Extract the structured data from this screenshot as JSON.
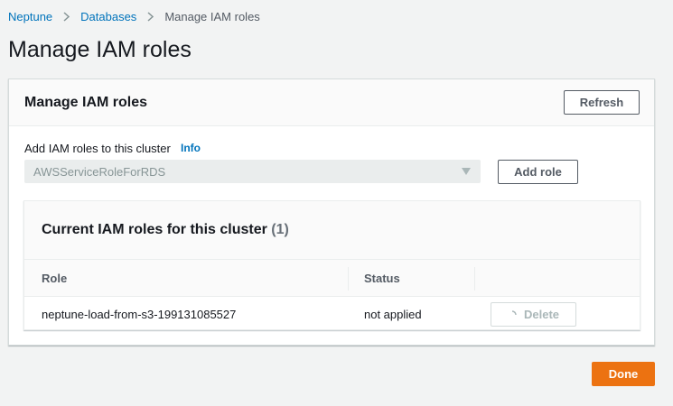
{
  "breadcrumb": {
    "items": [
      {
        "label": "Neptune"
      },
      {
        "label": "Databases"
      },
      {
        "label": "Manage IAM roles"
      }
    ]
  },
  "page": {
    "title": "Manage IAM roles"
  },
  "panel": {
    "title": "Manage IAM roles",
    "refresh_label": "Refresh",
    "add_roles_label": "Add IAM roles to this cluster",
    "info_label": "Info",
    "select_value": "AWSServiceRoleForRDS",
    "add_role_label": "Add role"
  },
  "current_roles": {
    "title": "Current IAM roles for this cluster",
    "count": "(1)",
    "columns": [
      "Role",
      "Status"
    ],
    "rows": [
      {
        "role": "neptune-load-from-s3-199131085527",
        "status": "not applied",
        "action_label": "Delete"
      }
    ]
  },
  "footer": {
    "done_label": "Done"
  },
  "colors": {
    "link": "#0073bb",
    "primary": "#ec7211",
    "background": "#f2f3f3"
  }
}
